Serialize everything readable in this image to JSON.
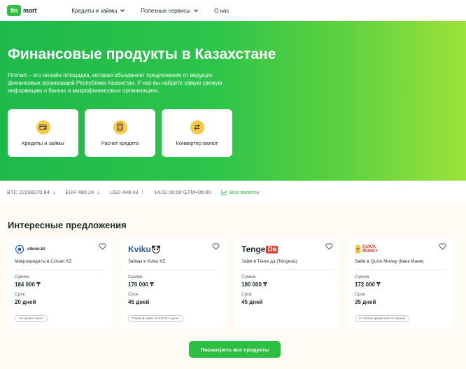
{
  "header": {
    "logo_badge": "fin",
    "logo_text": "mart",
    "nav": [
      {
        "label": "Кредиты и займы"
      },
      {
        "label": "Полезные сервисы"
      },
      {
        "label": "О нас"
      }
    ]
  },
  "hero": {
    "title": "Финансовые продукты в Казахстане",
    "description": "Finmart – это онлайн площадка, которая объединяет предложения от ведущих финансовых организаций Республики Казахстан. У нас вы найдете самую свежую информацию о банках и микрофинансовых организациях.",
    "tiles": [
      {
        "label": "Кредиты и займы",
        "icon": "credit-card-icon"
      },
      {
        "label": "Расчет кредита",
        "icon": "calculator-icon"
      },
      {
        "label": "Конвертер валют",
        "icon": "exchange-icon"
      }
    ]
  },
  "rates": {
    "btc": "BTC 22298270.84",
    "eur": "EUR 480.24",
    "usd": "USD 448.43",
    "datetime": "14.02 06:00 GTM+06:00",
    "all_rates_label": "Все валюты"
  },
  "offers": {
    "title": "Интересные предложения",
    "amount_label": "Сумма",
    "term_label": "Срок",
    "cards": [
      {
        "logo": "cdeon.kz",
        "name": "Микрокредиты в Ccloan KZ",
        "amount": "184 000 ₸",
        "term": "20 дней",
        "tag": "Не нужен залог"
      },
      {
        "logo": "Kviku",
        "name": "Займы в Kviku KZ",
        "amount": "170 000 ₸",
        "term": "45 дней",
        "tag": "Первый займ от 0,01% в день"
      },
      {
        "logo_a": "Tenge",
        "logo_b": "Da",
        "name": "Займ в Тенге да (Tengeda)",
        "amount": "180 000 ₸",
        "term": "45 дней",
        "tag": ""
      },
      {
        "logo_a": "QUICK",
        "logo_b": "MONEY",
        "name": "Займ в Quick Money (Квик Мани)",
        "amount": "172 000 ₸",
        "term": "35 дней",
        "tag": "С любой кредитной историей"
      }
    ],
    "cta_label": "Посмотреть все продукты"
  },
  "colors": {
    "brand_green": "#2dbf3f",
    "accent_yellow": "#f7c84a",
    "rate_down": "#e0392e",
    "rate_up": "#2dbf3f"
  }
}
